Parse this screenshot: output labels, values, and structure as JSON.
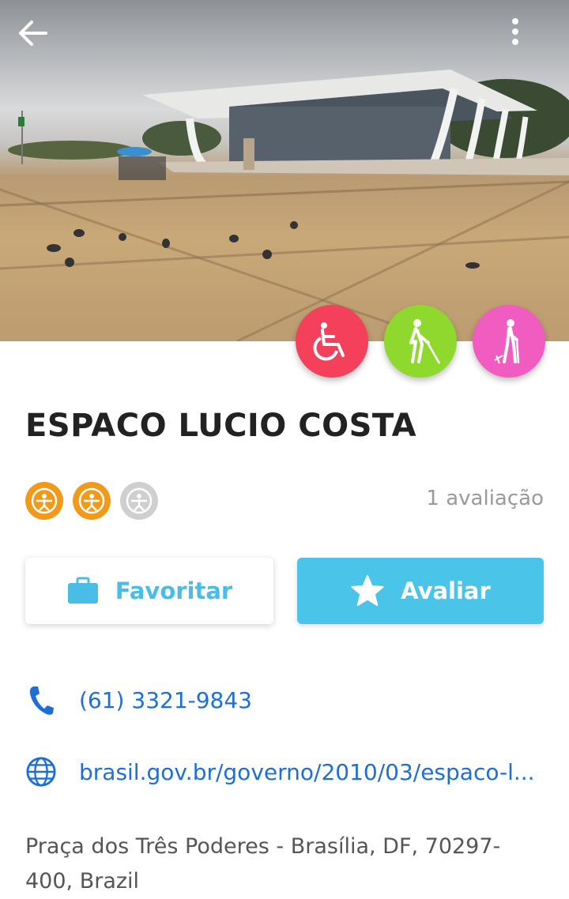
{
  "header": {
    "back_icon": "arrow-left-icon",
    "menu_icon": "more-vertical-icon"
  },
  "accessibility": [
    {
      "name": "wheelchair",
      "color": "#f4405a"
    },
    {
      "name": "visual-impairment",
      "color": "#8fd92e"
    },
    {
      "name": "reduced-mobility",
      "color": "#f05cbf"
    }
  ],
  "place": {
    "name": "ESPACO LUCIO COSTA",
    "rating": 2,
    "rating_max": 3,
    "review_count": "1 avaliação"
  },
  "actions": {
    "favorite_label": "Favoritar",
    "rate_label": "Avaliar"
  },
  "contact": {
    "phone": "(61) 3321-9843",
    "website": "brasil.gov.br/governo/2010/03/espaco-l...",
    "address": "Praça dos Três Poderes - Brasília, DF, 70297-400, Brazil"
  },
  "colors": {
    "accent": "#4bc4ea",
    "link": "#1d6fd6",
    "rating_on": "#f19a1a",
    "rating_off": "#cfcfcf"
  }
}
